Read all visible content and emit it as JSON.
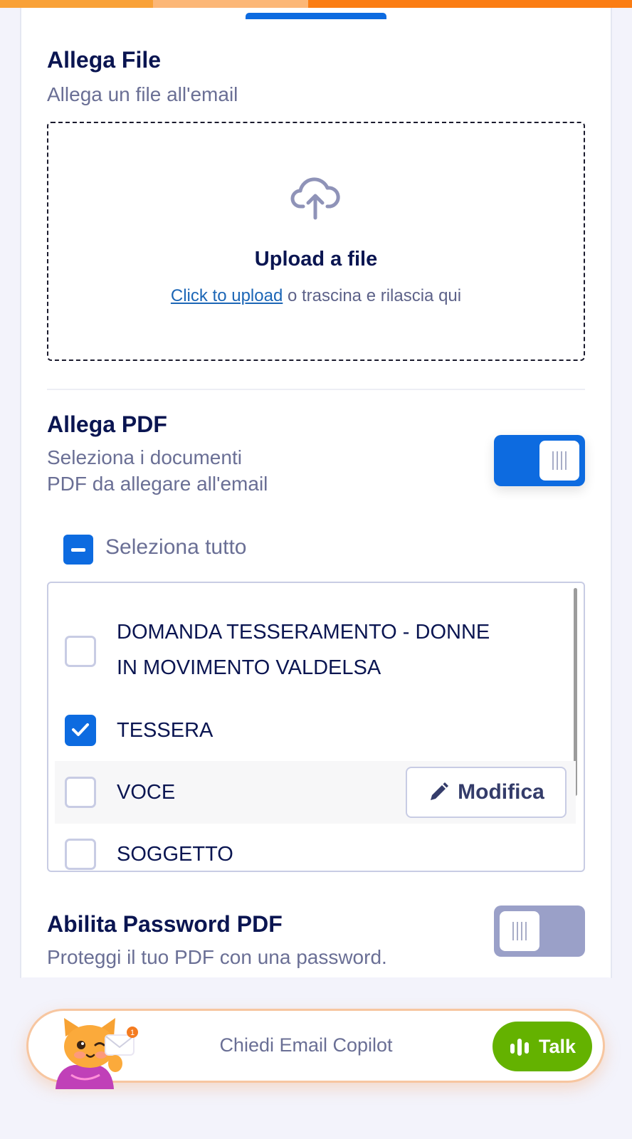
{
  "colors": {
    "accent": "#0d6be0",
    "text_primary": "#0a1551",
    "text_secondary": "#6a6f95",
    "link": "#1c66b6",
    "talk_green": "#64b200",
    "header_orange": "#fb7d13"
  },
  "attach_file": {
    "title": "Allega File",
    "subtitle": "Allega un file all'email",
    "upload_icon": "cloud-upload-icon",
    "upload_title": "Upload a file",
    "click_link": "Click to upload",
    "drag_text": " o trascina e rilascia qui"
  },
  "attach_pdf": {
    "title": "Allega PDF",
    "subtitle_line1": "Seleziona i documenti",
    "subtitle_line2": "PDF da allegare all'email",
    "toggle_on": true,
    "select_all_label": "Seleziona tutto",
    "items": [
      {
        "label_line1": "DOMANDA TESSERAMENTO - DONNE",
        "label_line2": "IN MOVIMENTO VALDELSA",
        "checked": false
      },
      {
        "label": "TESSERA",
        "checked": true
      },
      {
        "label": "VOCE",
        "checked": false,
        "edit_label": "Modifica"
      },
      {
        "label": "SOGGETTO",
        "checked": false
      }
    ]
  },
  "pdf_password": {
    "title": "Abilita Password PDF",
    "subtitle": "Proteggi il tuo PDF con una password.",
    "toggle_on": false
  },
  "copilot": {
    "placeholder": "Chiedi Email Copilot",
    "talk_label": "Talk",
    "mascot_icon": "cat-mascot-icon",
    "talk_icon": "audio-bars-icon"
  }
}
